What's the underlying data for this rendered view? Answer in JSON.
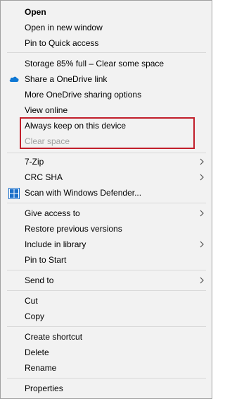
{
  "menu": {
    "open": "Open",
    "open_new_window": "Open in new window",
    "pin_quick_access": "Pin to Quick access",
    "storage_status": "Storage 85% full – Clear some space",
    "share_onedrive": "Share a OneDrive link",
    "more_onedrive": "More OneDrive sharing options",
    "view_online": "View online",
    "always_keep": "Always keep on this device",
    "clear_space": "Clear space",
    "seven_zip": "7-Zip",
    "crc_sha": "CRC SHA",
    "scan_defender": "Scan with Windows Defender...",
    "give_access": "Give access to",
    "restore_versions": "Restore previous versions",
    "include_library": "Include in library",
    "pin_start": "Pin to Start",
    "send_to": "Send to",
    "cut": "Cut",
    "copy": "Copy",
    "create_shortcut": "Create shortcut",
    "delete": "Delete",
    "rename": "Rename",
    "properties": "Properties"
  },
  "icons": {
    "onedrive": "cloud-icon",
    "defender": "windows-defender-icon",
    "submenu": "chevron-right-icon"
  },
  "colors": {
    "menu_bg": "#f2f2f2",
    "highlight_border": "#c11f2b",
    "disabled_text": "#a0a0a0",
    "onedrive_blue": "#0f78d4"
  }
}
